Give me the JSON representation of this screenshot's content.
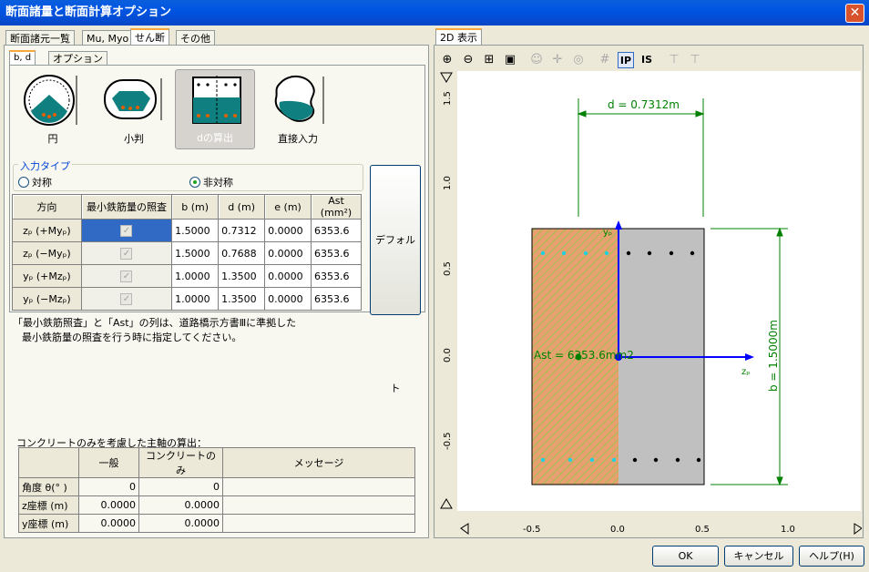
{
  "window": {
    "title": "断面諸量と断面計算オプション",
    "close_glyph": "✕"
  },
  "left_tabs": [
    "断面諸元一覧",
    "Mu, Myo",
    "せん断",
    "その他"
  ],
  "sub_tabs": [
    "b, d",
    "オプション"
  ],
  "shape_buttons": [
    "円",
    "小判",
    "dの算出",
    "直接入力"
  ],
  "input_type": {
    "label": "入力タイプ",
    "options": [
      "対称",
      "非対称"
    ],
    "selected": "非対称"
  },
  "shear_table": {
    "headers": [
      "方向",
      "最小鉄筋量の照査",
      "b (m)",
      "d (m)",
      "e (m)",
      "Ast (mm²)"
    ],
    "rows": [
      {
        "dir": "zₚ (+Myₚ)",
        "b": "1.5000",
        "d": "0.7312",
        "e": "0.0000",
        "ast": "6353.6"
      },
      {
        "dir": "zₚ (−Myₚ)",
        "b": "1.5000",
        "d": "0.7688",
        "e": "0.0000",
        "ast": "6353.6"
      },
      {
        "dir": "yₚ (+Mzₚ)",
        "b": "1.0000",
        "d": "1.3500",
        "e": "0.0000",
        "ast": "6353.6"
      },
      {
        "dir": "yₚ (−Mzₚ)",
        "b": "1.0000",
        "d": "1.3500",
        "e": "0.0000",
        "ast": "6353.6"
      }
    ]
  },
  "default_button": "デフォルト",
  "note_lines": [
    "「最小鉄筋照査」と「Ast」の列は、道路橋示方書Ⅲに準拠した",
    "最小鉄筋量の照査を行う時に指定してください。"
  ],
  "axis_section": {
    "title": "コンクリートのみを考慮した主軸の算出：",
    "headers": [
      "",
      "一般",
      "コンクリートのみ",
      "メッセージ"
    ],
    "rows": [
      {
        "label": "角度 θ(° )",
        "general": "0",
        "concrete": "0"
      },
      {
        "label": "z座標 (m)",
        "general": "0.0000",
        "concrete": "0.0000"
      },
      {
        "label": "y座標 (m)",
        "general": "0.0000",
        "concrete": "0.0000"
      }
    ]
  },
  "right_tab": "2D 表示",
  "toolbar_icons": [
    "zoom-in-icon",
    "zoom-out-icon",
    "fit-icon",
    "frame-icon",
    "pan-face-icon",
    "move-icon",
    "rotate-icon",
    "grid-icon",
    "ip-icon",
    "is-icon",
    "support-icon",
    "support2-icon"
  ],
  "plot": {
    "d_label": "d = 0.7312m",
    "b_label": "b = 1.5000m",
    "ast_label": "Ast = 6353.6mm2",
    "y_axis_label": "yₚ",
    "z_axis_label": "zₚ",
    "x_ticks": [
      "-0.5",
      "0.0",
      "0.5",
      "1.0"
    ],
    "y_ticks": [
      "1.5",
      "1.0",
      "0.5",
      "0.0",
      "-0.5"
    ],
    "colors": {
      "hatch_fill": "#e8a070",
      "hatch_line": "#a0c050",
      "concrete": "#c0c0c0",
      "dim": "#008000",
      "axis": "#0000ff"
    }
  },
  "buttons": {
    "ok": "OK",
    "cancel": "キャンセル",
    "help": "ヘルプ(H)"
  }
}
